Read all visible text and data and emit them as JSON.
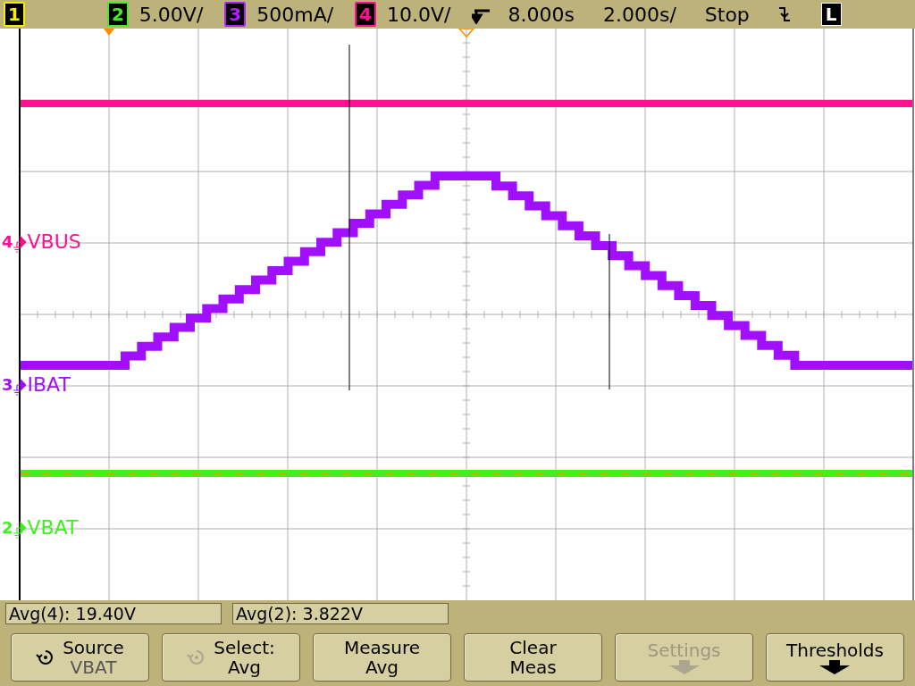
{
  "top_bar": {
    "channels": [
      {
        "number": "1",
        "color": "#f0f000"
      },
      {
        "number": "2",
        "color": "#40f020",
        "scale": "5.00V/"
      },
      {
        "number": "3",
        "color": "#b020ff",
        "scale": "500mA/"
      },
      {
        "number": "4",
        "color": "#ff1090",
        "scale": "10.0V/"
      }
    ],
    "delay": "8.000s",
    "timebase": "2.000s/",
    "run_state": "Stop",
    "mode": "L"
  },
  "traces": [
    {
      "label": "VBUS",
      "number": "4",
      "color": "#ff1090",
      "kind": "flat"
    },
    {
      "label": "IBAT",
      "number": "3",
      "color": "#a010ff",
      "kind": "ramp"
    },
    {
      "label": "VBAT",
      "number": "2",
      "color": "#40f020",
      "kind": "flat"
    }
  ],
  "measurements": [
    "Avg(4): 19.40V",
    "Avg(2): 3.822V"
  ],
  "softkeys": [
    {
      "kind": "cycle",
      "title": "Source",
      "value": "VBAT",
      "disabled": false,
      "cycle_active": true
    },
    {
      "kind": "cycle",
      "title": "Select:",
      "value": "Avg",
      "disabled": false,
      "cycle_active": false
    },
    {
      "kind": "plain",
      "title": "Measure",
      "value": "Avg",
      "disabled": false
    },
    {
      "kind": "plain",
      "title": "Clear",
      "value": "Meas",
      "disabled": false
    },
    {
      "kind": "menu",
      "title": "Settings",
      "disabled": true
    },
    {
      "kind": "menu",
      "title": "Thresholds",
      "disabled": false
    }
  ]
}
